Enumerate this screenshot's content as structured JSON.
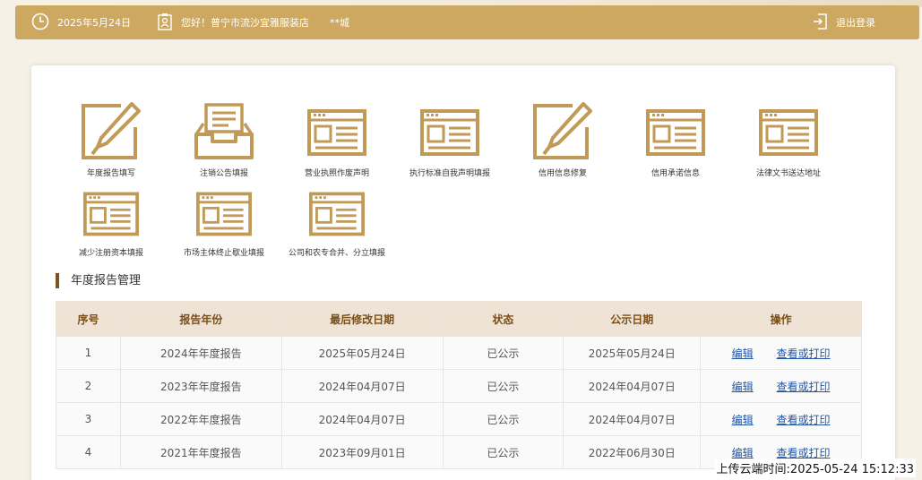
{
  "header": {
    "date": "2025年5月24日",
    "greeting": "您好！普宁市流沙宜雅服装店",
    "city": "**城",
    "logout_label": "退出登录"
  },
  "tiles": [
    {
      "label": "年度报告填写",
      "icon": "edit-document-icon"
    },
    {
      "label": "注销公告填报",
      "icon": "inbox-tray-icon"
    },
    {
      "label": "营业执照作废声明",
      "icon": "form-window-icon"
    },
    {
      "label": "执行标准自我声明填报",
      "icon": "form-window-icon"
    },
    {
      "label": "信用信息修复",
      "icon": "edit-document-icon"
    },
    {
      "label": "信用承诺信息",
      "icon": "form-window-icon"
    },
    {
      "label": "法律文书送达地址",
      "icon": "form-window-icon"
    },
    {
      "label": "减少注册资本填报",
      "icon": "form-window-icon"
    },
    {
      "label": "市场主体终止歇业填报",
      "icon": "form-window-icon"
    },
    {
      "label": "公司和农专合并、分立填报",
      "icon": "form-window-icon"
    }
  ],
  "section_title": "年度报告管理",
  "table": {
    "headers": [
      "序号",
      "报告年份",
      "最后修改日期",
      "状态",
      "公示日期",
      "操作"
    ],
    "edit_label": "编辑",
    "view_label": "查看或打印",
    "rows": [
      [
        "1",
        "2024年年度报告",
        "2025年05月24日",
        "已公示",
        "2025年05月24日"
      ],
      [
        "2",
        "2023年年度报告",
        "2024年04月07日",
        "已公示",
        "2024年04月07日"
      ],
      [
        "3",
        "2022年年度报告",
        "2024年04月07日",
        "已公示",
        "2024年04月07日"
      ],
      [
        "4",
        "2021年年度报告",
        "2023年09月01日",
        "已公示",
        "2022年06月30日"
      ]
    ]
  },
  "upload_stamp": "上传云端时间:2025-05-24 15:12:33",
  "colors": {
    "brand": "#cda861",
    "accent_dark": "#7b5416",
    "link": "#1f57a6"
  }
}
